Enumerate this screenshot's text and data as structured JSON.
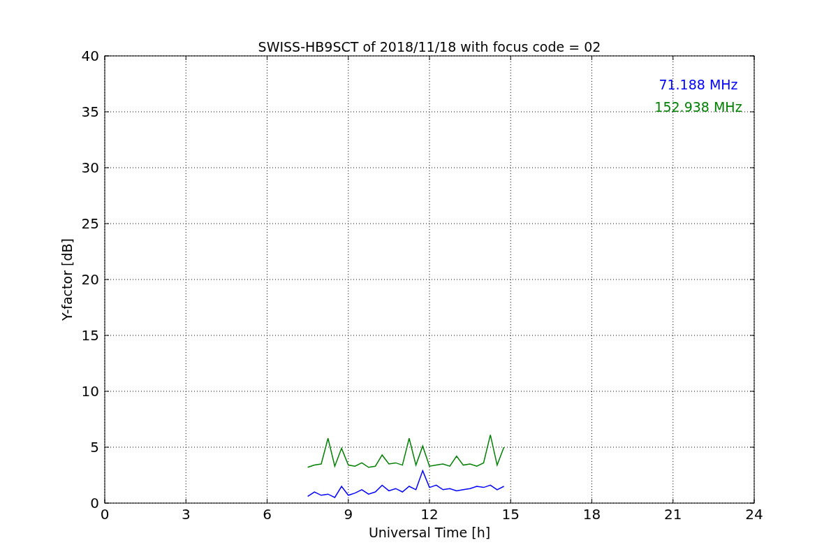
{
  "chart_data": {
    "type": "line",
    "title": "SWISS-HB9SCT of 2018/11/18 with focus code = 02",
    "xlabel": "Universal Time [h]",
    "ylabel": "Y-factor [dB]",
    "x": [
      7.5,
      7.75,
      8.0,
      8.25,
      8.5,
      8.75,
      9.0,
      9.25,
      9.5,
      9.75,
      10.0,
      10.25,
      10.5,
      10.75,
      11.0,
      11.25,
      11.5,
      11.75,
      12.0,
      12.25,
      12.5,
      12.75,
      13.0,
      13.25,
      13.5,
      13.75,
      14.0,
      14.25,
      14.5,
      14.75
    ],
    "series": [
      {
        "name": "71.188 MHz",
        "color": "#0000ff",
        "values": [
          0.6,
          1.0,
          0.7,
          0.8,
          0.5,
          1.5,
          0.7,
          0.9,
          1.2,
          0.8,
          1.0,
          1.6,
          1.1,
          1.3,
          1.0,
          1.5,
          1.2,
          2.9,
          1.4,
          1.6,
          1.2,
          1.3,
          1.1,
          1.2,
          1.3,
          1.5,
          1.4,
          1.6,
          1.2,
          1.5
        ]
      },
      {
        "name": "152.938 MHz",
        "color": "#008000",
        "values": [
          3.2,
          3.4,
          3.5,
          5.8,
          3.3,
          4.9,
          3.4,
          3.3,
          3.6,
          3.2,
          3.3,
          4.3,
          3.5,
          3.6,
          3.4,
          5.8,
          3.4,
          5.1,
          3.3,
          3.4,
          3.5,
          3.3,
          4.2,
          3.4,
          3.5,
          3.3,
          3.6,
          6.1,
          3.4,
          5.0
        ]
      }
    ],
    "xlim": [
      0,
      24
    ],
    "ylim": [
      0,
      40
    ],
    "xticks": [
      0,
      3,
      6,
      9,
      12,
      15,
      18,
      21,
      24
    ],
    "yticks": [
      0,
      5,
      10,
      15,
      20,
      25,
      30,
      35,
      40
    ],
    "grid": true
  }
}
